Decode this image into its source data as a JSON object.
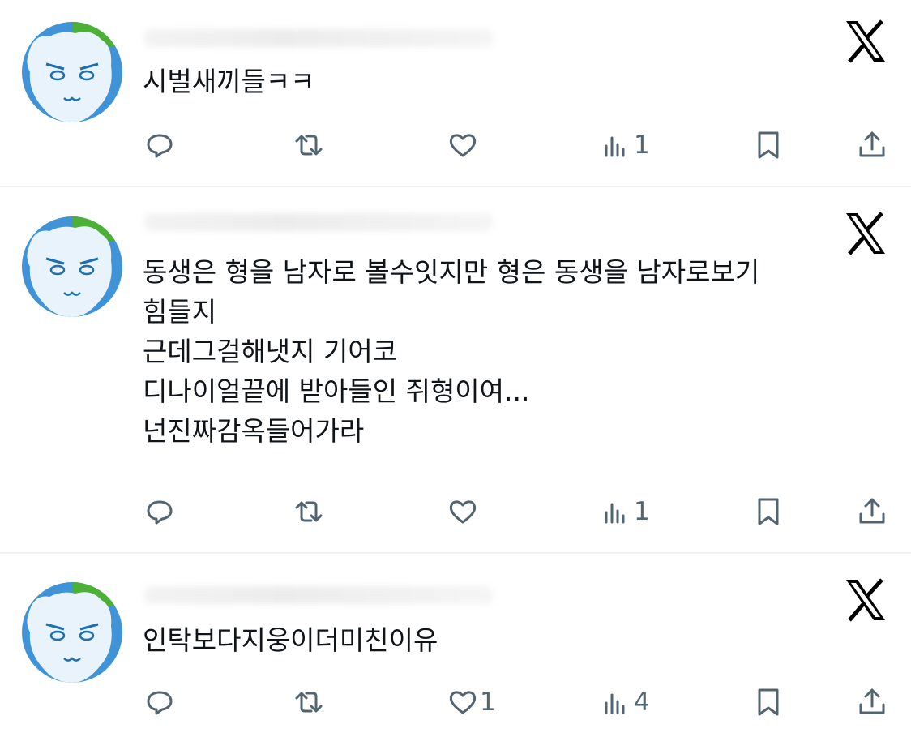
{
  "colors": {
    "text": "#0f1419",
    "icon": "#536471",
    "divider": "#eff3f4",
    "avatar_bg": "#3f93d6",
    "avatar_accent": "#4caf36"
  },
  "icons": {
    "reply": "reply-icon",
    "retweet": "retweet-icon",
    "like": "heart-icon",
    "views": "views-icon",
    "bookmark": "bookmark-icon",
    "share": "share-icon",
    "platform": "x-logo-icon"
  },
  "tweets": [
    {
      "lines": [
        "시벌새끼들ㅋㅋ"
      ],
      "reply_count": "",
      "retweet_count": "",
      "like_count": "",
      "view_count": "1"
    },
    {
      "lines": [
        "동생은 형을 남자로 볼수잇지만 형은 동생을 남자로보기",
        "힘들지",
        "근데그걸해냇지 기어코",
        "디나이얼끝에 받아들인 쥐형이여...",
        "넌진짜감옥들어가라"
      ],
      "reply_count": "",
      "retweet_count": "",
      "like_count": "",
      "view_count": "1"
    },
    {
      "lines": [
        "인탁보다지웅이더미친이유"
      ],
      "reply_count": "",
      "retweet_count": "",
      "like_count": "1",
      "view_count": "4"
    }
  ]
}
